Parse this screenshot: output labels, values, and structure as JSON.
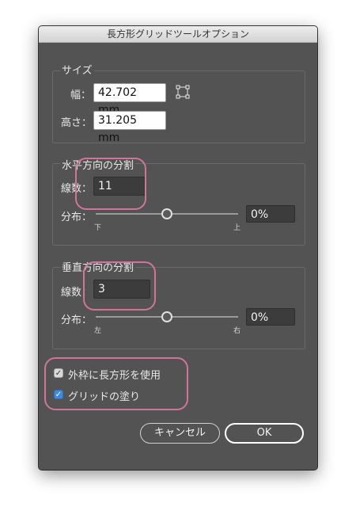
{
  "window": {
    "title": "長方形グリッドツールオプション"
  },
  "size": {
    "legend": "サイズ",
    "width_label": "幅：",
    "width_value": "42.702 mm",
    "height_label": "高さ：",
    "height_value": "31.205 mm",
    "reference_point_icon": "reference-point-locator-icon"
  },
  "horizontal": {
    "legend": "水平方向の分割",
    "count_label": "線数：",
    "count_value": "11",
    "skew_label": "分布：",
    "skew_value": "0%",
    "skew_level": 0,
    "min_label": "下",
    "max_label": "上"
  },
  "vertical": {
    "legend": "垂直方向の分割",
    "count_label": "線数：",
    "count_value": "3",
    "skew_label": "分布：",
    "skew_value": "0%",
    "skew_level": 0,
    "min_label": "左",
    "max_label": "右"
  },
  "options": {
    "use_outside_rect": {
      "label": "外枠に長方形を使用",
      "checked": true
    },
    "fill_grid": {
      "label": "グリッドの塗り",
      "checked": true
    }
  },
  "buttons": {
    "cancel": "キャンセル",
    "ok": "OK"
  },
  "colors": {
    "dialog_bg": "#535353",
    "highlight": "#d0749a",
    "checkbox_blue": "#3d8ae6"
  }
}
